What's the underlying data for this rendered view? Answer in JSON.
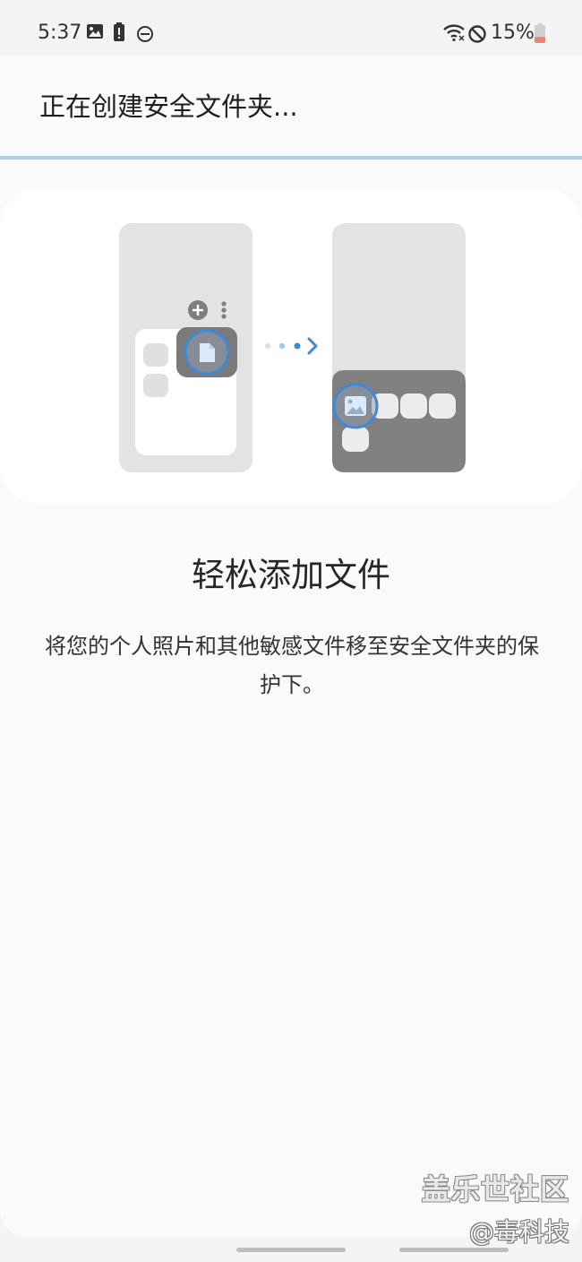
{
  "status_bar": {
    "time": "5:37",
    "battery_percent": "15%"
  },
  "app_bar": {
    "title": "正在创建安全文件夹..."
  },
  "progress": {
    "value_percent": 100
  },
  "onboarding": {
    "heading": "轻松添加文件",
    "description": "将您的个人照片和其他敏感文件移至安全文件夹的保护下。"
  },
  "watermark": {
    "line1": "盖乐世社区",
    "line2": "@毒科技"
  },
  "colors": {
    "accent": "#3f8ad8",
    "progress_bar": "#a9d0ef",
    "battery_low": "#e9866e"
  }
}
